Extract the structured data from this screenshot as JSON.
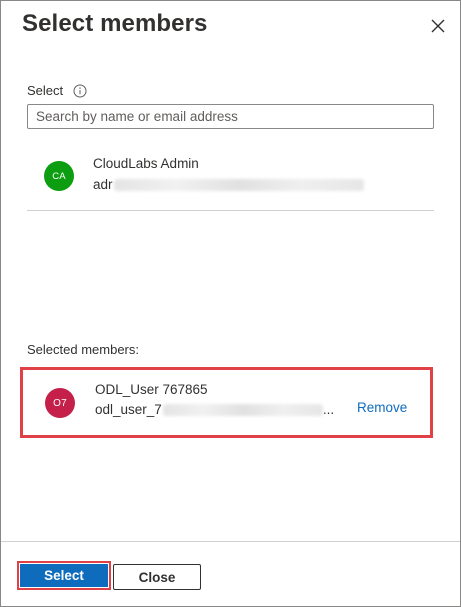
{
  "dialog": {
    "title": "Select members",
    "close_icon": "close-icon"
  },
  "search": {
    "label": "Select",
    "info_icon": "info-icon",
    "placeholder": "Search by name or email address",
    "value": ""
  },
  "results": [
    {
      "initials": "CA",
      "avatar_color": "#0c9e10",
      "name": "CloudLabs Admin",
      "email_visible": "adr"
    }
  ],
  "selected": {
    "heading": "Selected members:",
    "members": [
      {
        "initials": "O7",
        "avatar_color": "#c4204a",
        "name": "ODL_User 767865",
        "email_visible_prefix": "odl_user_7",
        "email_visible_suffix": "...",
        "remove_label": "Remove"
      }
    ]
  },
  "footer": {
    "select_label": "Select",
    "close_label": "Close"
  },
  "colors": {
    "accent": "#0f6cbd",
    "highlight_border": "#e04146"
  }
}
